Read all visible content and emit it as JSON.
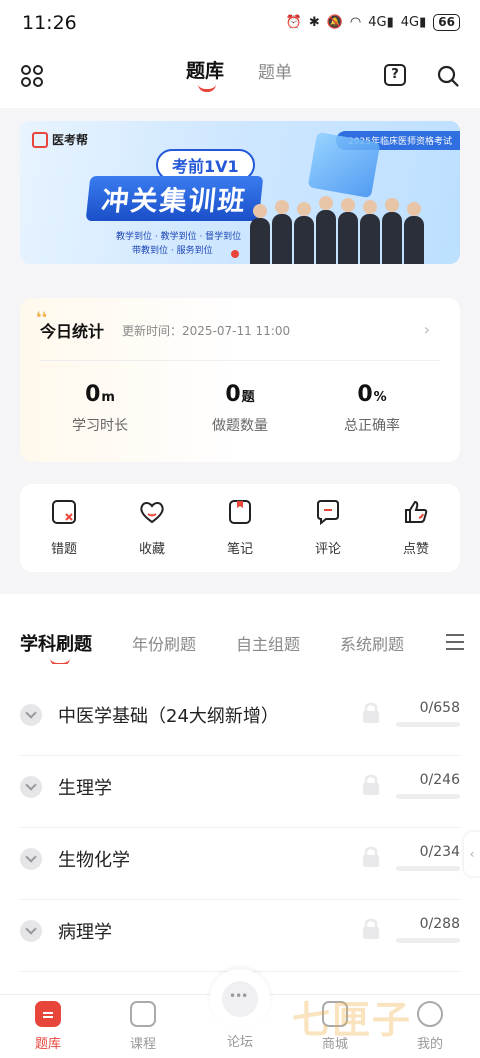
{
  "status_bar": {
    "time": "11:26",
    "signal1": "4G",
    "signal2": "4G",
    "battery": "66"
  },
  "header": {
    "tab_main": "题库",
    "tab_secondary": "题单",
    "help_glyph": "?"
  },
  "banner": {
    "brand": "医考帮",
    "exam_tag": "2025年临床医师资格考试",
    "pill": "考前1V1",
    "headline": "冲关集训班",
    "slogan_line1": "教学到位 · 教学到位 · 督学到位",
    "slogan_line2": "带教到位 · 服务到位"
  },
  "stats": {
    "title": "今日统计",
    "updated": "更新时间：2025-07-11 11:00",
    "items": [
      {
        "value": "0",
        "unit": "m",
        "label": "学习时长"
      },
      {
        "value": "0",
        "unit": "题",
        "label": "做题数量"
      },
      {
        "value": "0",
        "unit": "%",
        "label": "总正确率"
      }
    ]
  },
  "tools": [
    {
      "label": "错题",
      "icon": "wrong-answers-icon"
    },
    {
      "label": "收藏",
      "icon": "heart-icon"
    },
    {
      "label": "笔记",
      "icon": "notes-icon"
    },
    {
      "label": "评论",
      "icon": "comment-icon"
    },
    {
      "label": "点赞",
      "icon": "thumbs-up-icon"
    }
  ],
  "subject_tabs": [
    "学科刷题",
    "年份刷题",
    "自主组题",
    "系统刷题"
  ],
  "subjects": [
    {
      "name": "中医学基础（24大纲新增）",
      "count": "0/658"
    },
    {
      "name": "生理学",
      "count": "0/246"
    },
    {
      "name": "生物化学",
      "count": "0/234"
    },
    {
      "name": "病理学",
      "count": "0/288"
    }
  ],
  "side_tab": "‹",
  "nav": [
    {
      "label": "题库"
    },
    {
      "label": "课程"
    },
    {
      "label": "论坛"
    },
    {
      "label": "商城"
    },
    {
      "label": "我的"
    }
  ],
  "watermark": "七匣子",
  "colors": {
    "accent": "#e8463b",
    "banner_blue": "#2458d8"
  }
}
